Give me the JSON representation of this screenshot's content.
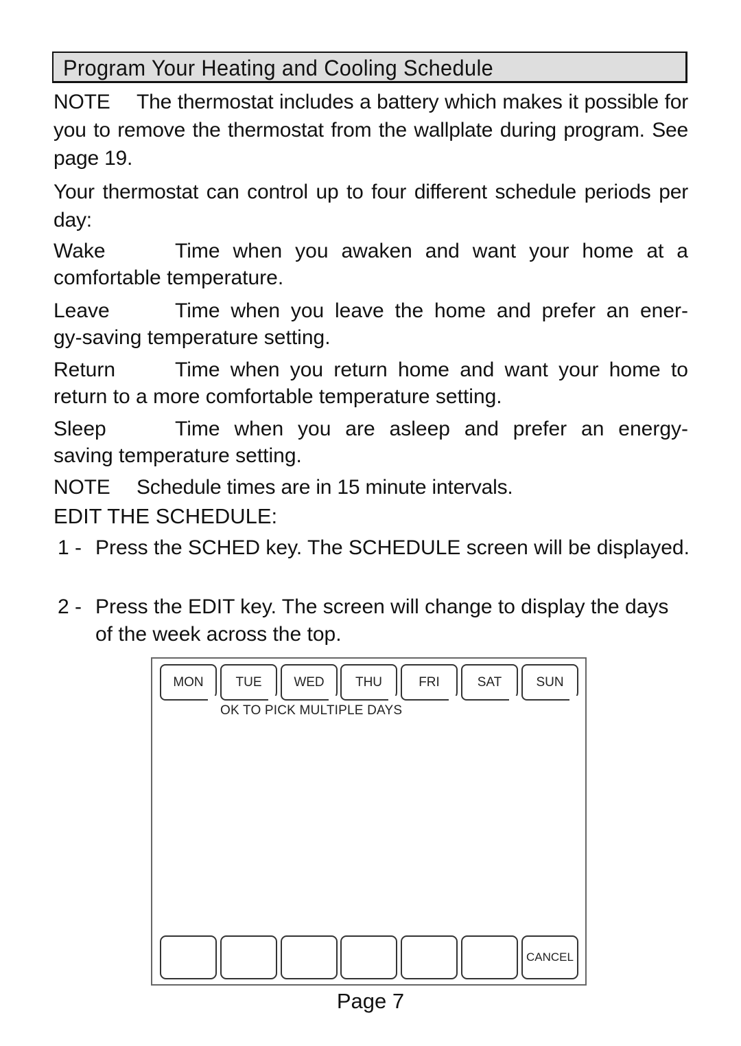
{
  "header": {
    "title": "Program Your Heating and Cooling Schedule"
  },
  "note1": {
    "label": "NOTE",
    "text": "The thermostat includes a battery which makes it possible for you to remove the thermostat from the wallplate during program. See page 19."
  },
  "intro": "Your thermostat can control up to four different schedule periods per day:",
  "periods": [
    {
      "label": "Wake",
      "line1": "Time when you awaken and want your home at a",
      "line2": "comfortable temperature."
    },
    {
      "label": "Leave",
      "line1": "Time when you leave the home and prefer an ener-",
      "line2": "gy-saving temperature setting."
    },
    {
      "label": "Return",
      "line1": "Time when you return home and want your home to",
      "line2": "return to a more comfortable temperature setting."
    },
    {
      "label": "Sleep",
      "line1": "Time when you are asleep and prefer an energy-",
      "line2": "saving temperature setting."
    }
  ],
  "note2": {
    "label": "NOTE",
    "text": "Schedule times are in 15 minute intervals."
  },
  "section_heading": "EDIT THE SCHEDULE:",
  "steps": [
    {
      "num": "1 -",
      "text": "Press the SCHED key. The SCHEDULE screen will be displayed."
    },
    {
      "num": "2 -",
      "text": "Press the EDIT key. The screen will change to display the days of the week across the top."
    }
  ],
  "screen": {
    "days": [
      "MON",
      "TUE",
      "WED",
      "THU",
      "FRI",
      "SAT",
      "SUN"
    ],
    "hint": "OK TO PICK MULTIPLE DAYS",
    "soft_keys": [
      "",
      "",
      "",
      "",
      "",
      "",
      "CANCEL"
    ]
  },
  "footer": {
    "page": "Page 7"
  }
}
